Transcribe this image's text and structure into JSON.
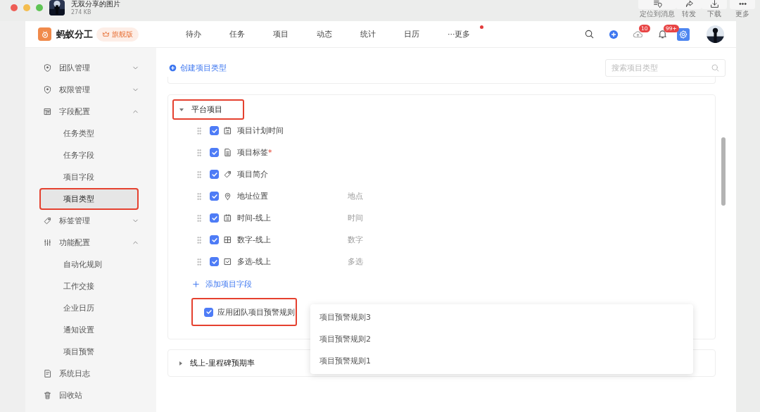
{
  "viewer": {
    "title": "无双分享的图片",
    "size": "274 KB",
    "actions": [
      {
        "label": "定位到消息",
        "kind": "locate"
      },
      {
        "label": "转发",
        "kind": "share"
      },
      {
        "label": "下载",
        "kind": "download"
      },
      {
        "label": "更多",
        "kind": "more"
      }
    ]
  },
  "app": {
    "name": "蚂蚁分工",
    "edition": "旗舰版"
  },
  "nav": [
    {
      "label": "待办",
      "unread": false
    },
    {
      "label": "任务",
      "unread": false
    },
    {
      "label": "项目",
      "unread": false
    },
    {
      "label": "动态",
      "unread": false
    },
    {
      "label": "统计",
      "unread": false
    },
    {
      "label": "日历",
      "unread": false
    },
    {
      "label": "···更多",
      "unread": true
    }
  ],
  "header_badges": {
    "sync": "10",
    "notifications": "99+"
  },
  "sidebar": [
    {
      "label": "团队管理",
      "kind": "shield",
      "expanded": false
    },
    {
      "label": "权限管理",
      "kind": "shield",
      "expanded": false
    },
    {
      "label": "字段配置",
      "kind": "table",
      "expanded": true,
      "children": [
        {
          "label": "任务类型",
          "selected": false,
          "highlighted": false
        },
        {
          "label": "任务字段",
          "selected": false,
          "highlighted": false
        },
        {
          "label": "项目字段",
          "selected": false,
          "highlighted": false
        },
        {
          "label": "项目类型",
          "selected": true,
          "highlighted": true
        }
      ]
    },
    {
      "label": "标签管理",
      "kind": "tag",
      "expanded": false
    },
    {
      "label": "功能配置",
      "kind": "sliders",
      "expanded": true,
      "children": [
        {
          "label": "自动化规则",
          "selected": false,
          "highlighted": false
        },
        {
          "label": "工作交接",
          "selected": false,
          "highlighted": false
        },
        {
          "label": "企业日历",
          "selected": false,
          "highlighted": false
        },
        {
          "label": "通知设置",
          "selected": false,
          "highlighted": false
        },
        {
          "label": "项目预警",
          "selected": false,
          "highlighted": false
        }
      ]
    },
    {
      "label": "系统日志",
      "kind": "log"
    },
    {
      "label": "回收站",
      "kind": "trash"
    }
  ],
  "create_link": "创建项目类型",
  "search": {
    "placeholder": "搜索项目类型"
  },
  "project_types": [
    {
      "name": "平台项目",
      "expanded": true,
      "highlighted": true,
      "fields": [
        {
          "name": "项目计划时间",
          "kind": "date",
          "checked": true
        },
        {
          "name": "项目标签",
          "required_mark": "*",
          "kind": "doc",
          "checked": true
        },
        {
          "name": "项目简介",
          "kind": "tag",
          "checked": true
        },
        {
          "name": "地址位置",
          "type": "地点",
          "kind": "location",
          "checked": true
        },
        {
          "name": "时间-线上",
          "type": "时间",
          "kind": "date",
          "checked": true
        },
        {
          "name": "数字-线上",
          "type": "数字",
          "kind": "number",
          "checked": true
        },
        {
          "name": "多选-线上",
          "type": "多选",
          "kind": "multiselect",
          "checked": true
        }
      ],
      "add_field": "添加项目字段",
      "warning_rule": {
        "label": "应用团队项目预警规则",
        "checked": true,
        "highlighted": true
      }
    },
    {
      "name": "线上-里程碑预期率",
      "expanded": false,
      "highlighted": false
    }
  ],
  "dropdown": [
    "项目预警规则3",
    "项目预警规则2",
    "项目预警规则1"
  ]
}
